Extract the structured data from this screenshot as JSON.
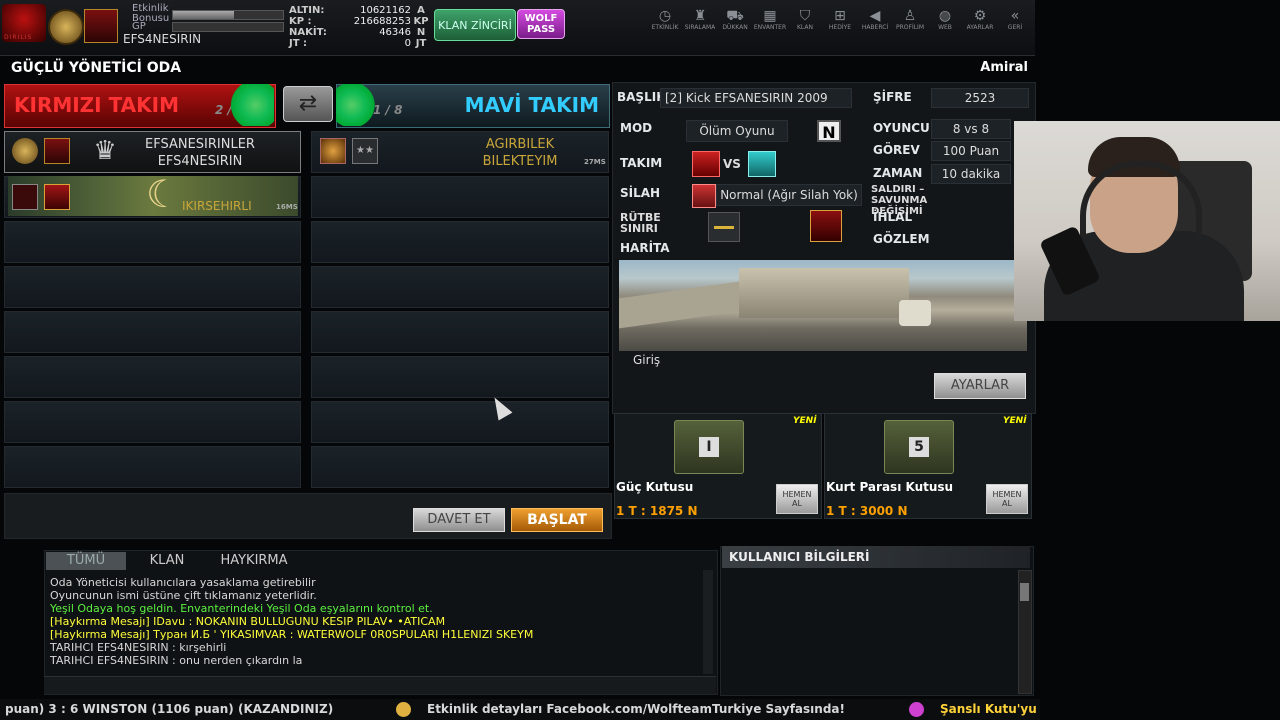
{
  "topbar": {
    "logo_text": "DIRILIS",
    "event_bonus_label": "Etkinlik Bonusu",
    "event_bonus_fill": 0.55,
    "gp_label": "GP",
    "gp_fill": 0.0,
    "username": "EFS4NESIRIN",
    "currency": [
      {
        "label": "ALTIN:",
        "value": "10621162",
        "unit": "A"
      },
      {
        "label": "KP :",
        "value": "216688253",
        "unit": "KP"
      },
      {
        "label": "NAKİT:",
        "value": "46346",
        "unit": "N"
      },
      {
        "label": "JT :",
        "value": "0",
        "unit": "JT"
      }
    ],
    "klan_button": "KLAN ZİNCİRİ",
    "wolf_pass_button": "WOLF PASS",
    "nav": [
      {
        "icon": "clock-icon",
        "glyph": "◷",
        "label": "ETKİNLİK"
      },
      {
        "icon": "ranking-icon",
        "glyph": "♜",
        "label": "SIRALAMA"
      },
      {
        "icon": "cart-icon",
        "glyph": "⛟",
        "label": "DÜKKAN"
      },
      {
        "icon": "inventory-icon",
        "glyph": "▦",
        "label": "ENVANTER"
      },
      {
        "icon": "clan-icon",
        "glyph": "⛉",
        "label": "KLAN"
      },
      {
        "icon": "gift-icon",
        "glyph": "⊞",
        "label": "HEDİYE"
      },
      {
        "icon": "megaphone-icon",
        "glyph": "◀",
        "label": "HABERCİ"
      },
      {
        "icon": "profile-icon",
        "glyph": "♙",
        "label": "PROFİLIM"
      },
      {
        "icon": "web-icon",
        "glyph": "◍",
        "label": "WEB"
      },
      {
        "icon": "settings-icon",
        "glyph": "⚙",
        "label": "AYARLAR"
      },
      {
        "icon": "back-icon",
        "glyph": "«",
        "label": "GERİ"
      }
    ]
  },
  "room": {
    "title": "GÜÇLÜ YÖNETİCİ ODA",
    "rank": "Amiral"
  },
  "teams": {
    "red": {
      "name": "KIRMIZI TAKIM",
      "count": "2 / 8"
    },
    "blue": {
      "name": "MAVİ TAKIM",
      "count": "1 / 8"
    }
  },
  "red_players": [
    {
      "name": "EFSANESIRINLER",
      "sub": "EFS4NESIRIN",
      "ms": ""
    },
    {
      "name": "IKIRSEHIRLI",
      "sub": "",
      "ms": "16MS"
    }
  ],
  "blue_players": [
    {
      "name": "AGIRBILEK",
      "sub": "BILEKTEYIM",
      "ms": "27MS"
    }
  ],
  "settings": {
    "baslik_label": "BAŞLIK",
    "baslik_value": "[2] Kick EFSANESIRIN 2009",
    "sifre_label": "ŞİFRE",
    "sifre_value": "2523",
    "mod_label": "MOD",
    "mod_value": "Ölüm Oyunu",
    "mod_badge": "N",
    "oyuncu_label": "OYUNCU",
    "oyuncu_value": "8 vs 8",
    "takim_label": "TAKIM",
    "vs_text": "VS",
    "gorev_label": "GÖREV",
    "gorev_value": "100 Puan",
    "zaman_label": "ZAMAN",
    "zaman_value": "10 dakika",
    "silah_label": "SİLAH",
    "silah_value": "Normal (Ağır Silah Yok)",
    "saldiri_label": "SALDIRI – SAVUNMA DEĞİŞİMİ",
    "rutbe_label": "RÜTBE SINIRI",
    "ihlal_label": "İHLAL",
    "gozlem_label": "GÖZLEM",
    "harita_label": "HARİTA",
    "map_name": "Giriş",
    "ayarlar_button": "AYARLAR"
  },
  "shop": [
    {
      "name": "Güç Kutusu",
      "price": "1 T : 1875 N",
      "badge": "YENİ",
      "crate_number": "I",
      "buy": "HEMEN AL"
    },
    {
      "name": "Kurt Parası Kutusu",
      "price": "1 T : 3000 N",
      "badge": "YENİ",
      "crate_number": "5",
      "buy": "HEMEN AL"
    }
  ],
  "actions": {
    "invite": "DAVET ET",
    "start": "BAŞLAT"
  },
  "chat": {
    "tabs": [
      "TÜMÜ",
      "KLAN",
      "HAYKIRMA"
    ],
    "lines": [
      {
        "text": "Oda Yöneticisi kullanıcılara yasaklama getirebilir",
        "color": "#d8d8d8"
      },
      {
        "text": "Oyuncunun ismi üstüne çift tıklamanız yeterlidir.",
        "color": "#d8d8d8"
      },
      {
        "text": "Yeşil Odaya hoş geldin. Envanterindeki Yeşil Oda eşyalarını kontrol et.",
        "color": "#5cf040"
      },
      {
        "text": "[Haykırma Mesajı] IDavu : NOKANIN BULLUGUNU KESIP PILAV• •ATICAM",
        "color": "#ffff3a"
      },
      {
        "text": "[Haykırma Mesajı] Туран И.Б  ' YIKASIMVAR : WATERWOLF 0R0SPULARI H1LENIZI SKEYM",
        "color": "#ffff3a"
      },
      {
        "text": "TARIHCI EFS4NESIRIN : kırşehirli",
        "color": "#d8d8d8"
      },
      {
        "text": "TARIHCI EFS4NESIRIN : onu nerden çıkardın la",
        "color": "#d8d8d8"
      }
    ]
  },
  "user_info": {
    "title": "KULLANICI BİLGİLERİ"
  },
  "ticker": {
    "segment1": "puan) 3 : 6 WINSTON (1106 puan) (KAZANDINIZ)",
    "segment2": "Etkinlik detayları Facebook.com/WolfteamTurkiye Sayfasında!",
    "segment3": "Şanslı Kutu'yu",
    "color1": "#d8d8d8",
    "color3": "#ffd23a"
  }
}
